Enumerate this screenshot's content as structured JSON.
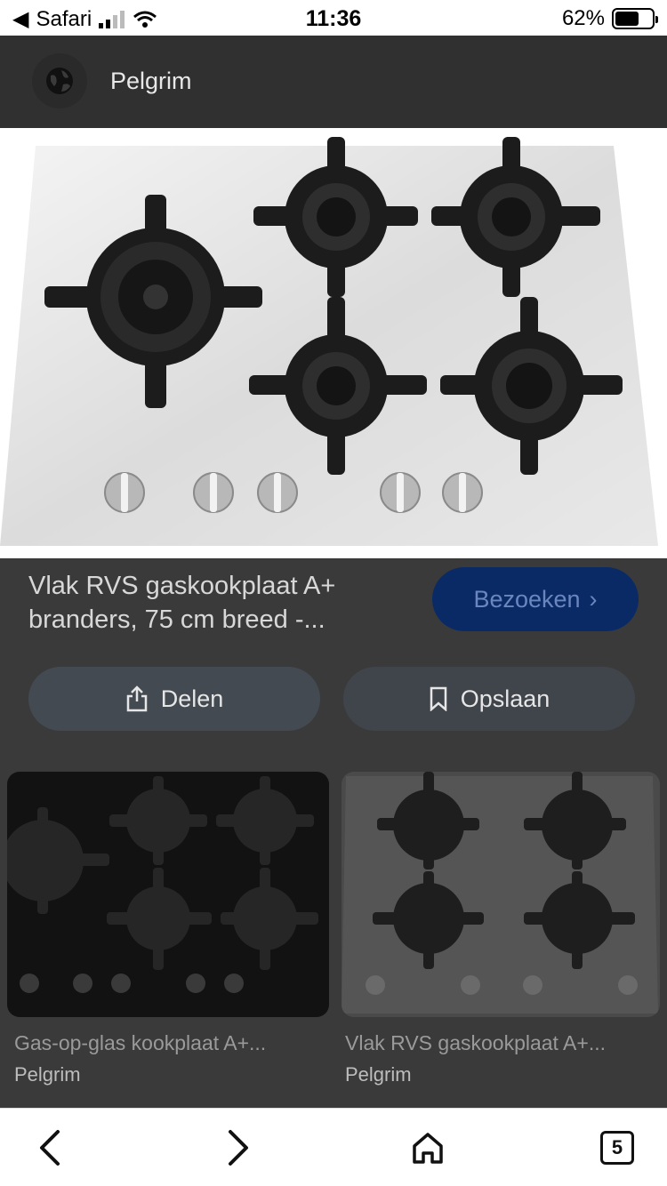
{
  "status_bar": {
    "carrier": "Safari",
    "time": "11:36",
    "battery": "62%",
    "battery_level": 0.62
  },
  "site": {
    "name": "Pelgrim",
    "icon": "globe-icon"
  },
  "result": {
    "title_line1": "Vlak RVS gaskookplaat A+",
    "title_line2": "branders, 75 cm breed -...",
    "visit_label": "Bezoeken",
    "share_label": "Delen",
    "save_label": "Opslaan"
  },
  "related": [
    {
      "title": "Gas-op-glas kookplaat A+...",
      "source": "Pelgrim"
    },
    {
      "title": "Vlak RVS gaskookplaat A+...",
      "source": "Pelgrim"
    }
  ],
  "toolbar": {
    "tab_count": "5"
  },
  "colors": {
    "visit_button": "#0a2a66",
    "overlay": "#3a3a3a"
  }
}
